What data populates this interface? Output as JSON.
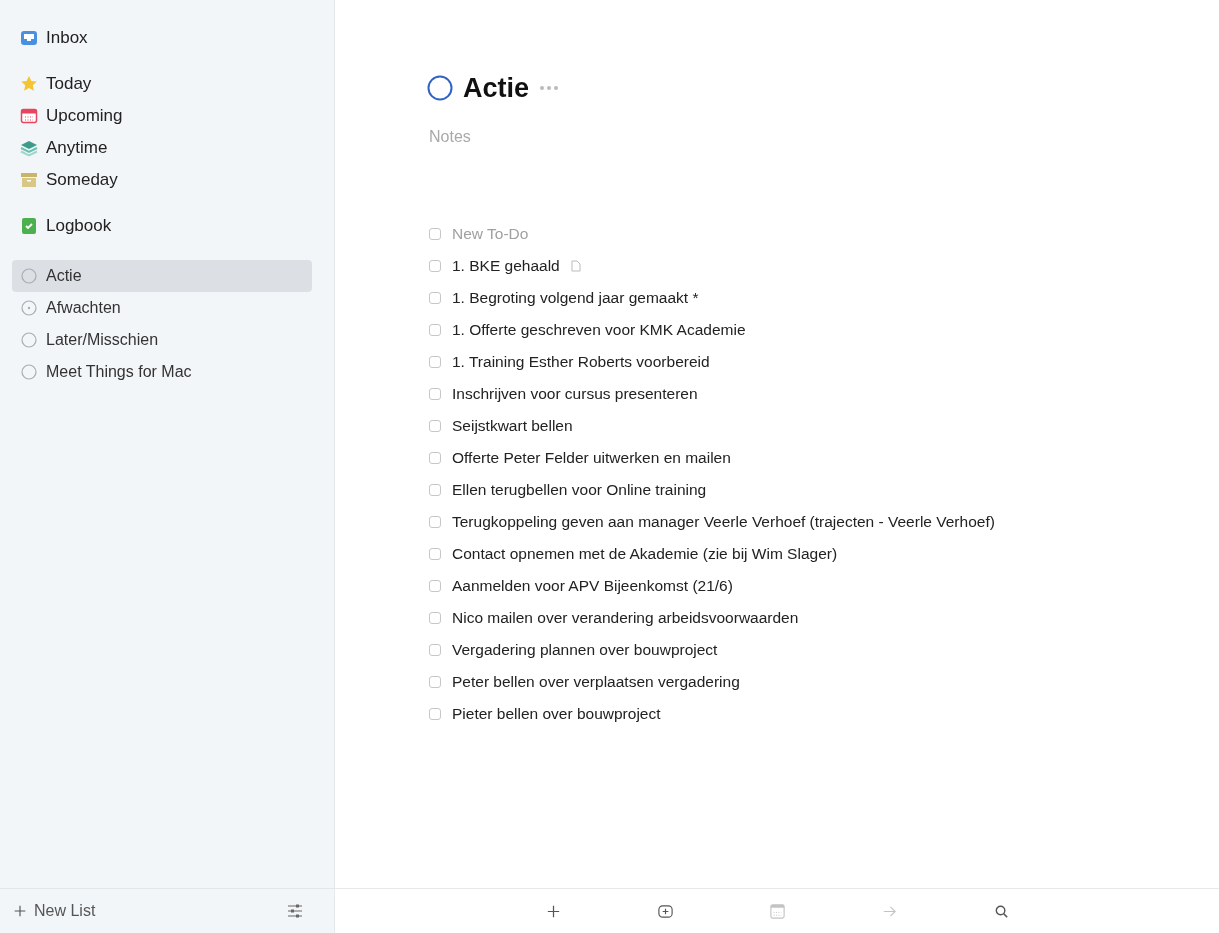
{
  "sidebar": {
    "groups": [
      {
        "items": [
          {
            "label": "Inbox",
            "kind": "inbox",
            "selected": false
          }
        ]
      },
      {
        "items": [
          {
            "label": "Today",
            "kind": "today",
            "selected": false
          },
          {
            "label": "Upcoming",
            "kind": "upcoming",
            "selected": false
          },
          {
            "label": "Anytime",
            "kind": "anytime",
            "selected": false
          },
          {
            "label": "Someday",
            "kind": "someday",
            "selected": false
          }
        ]
      },
      {
        "items": [
          {
            "label": "Logbook",
            "kind": "logbook",
            "selected": false
          }
        ]
      },
      {
        "items": [
          {
            "label": "Actie",
            "kind": "project",
            "selected": true
          },
          {
            "label": "Afwachten",
            "kind": "project-dotted",
            "selected": false
          },
          {
            "label": "Later/Misschien",
            "kind": "project",
            "selected": false
          },
          {
            "label": "Meet Things for Mac",
            "kind": "project",
            "selected": false
          }
        ]
      }
    ],
    "footer": {
      "new_list": "New List"
    }
  },
  "project": {
    "title": "Actie",
    "notes_placeholder": "Notes"
  },
  "tasks": [
    {
      "title": "New To-Do",
      "kind": "placeholder",
      "checked": false,
      "has_note": false
    },
    {
      "title": "1. BKE gehaald",
      "kind": "todo",
      "checked": false,
      "has_note": true
    },
    {
      "title": "1. Begroting volgend jaar gemaakt *",
      "kind": "todo",
      "checked": false,
      "has_note": false
    },
    {
      "title": "1. Offerte geschreven voor KMK Academie",
      "kind": "todo",
      "checked": false,
      "has_note": false
    },
    {
      "title": "1. Training Esther Roberts voorbereid",
      "kind": "todo",
      "checked": false,
      "has_note": false
    },
    {
      "title": "Inschrijven voor cursus presenteren",
      "kind": "todo",
      "checked": false,
      "has_note": false
    },
    {
      "title": "Seijstkwart bellen",
      "kind": "todo",
      "checked": false,
      "has_note": false
    },
    {
      "title": "Offerte Peter Felder uitwerken en mailen",
      "kind": "todo",
      "checked": false,
      "has_note": false
    },
    {
      "title": "Ellen terugbellen voor Online training",
      "kind": "todo",
      "checked": false,
      "has_note": false
    },
    {
      "title": "Terugkoppeling geven aan manager Veerle Verhoef (trajecten - Veerle Verhoef)",
      "kind": "todo",
      "checked": false,
      "has_note": false
    },
    {
      "title": "Contact opnemen met de Akademie (zie bij Wim Slager)",
      "kind": "todo",
      "checked": false,
      "has_note": false
    },
    {
      "title": "Aanmelden voor APV Bijeenkomst (21/6)",
      "kind": "todo",
      "checked": false,
      "has_note": false
    },
    {
      "title": "Nico mailen over verandering arbeidsvoorwaarden",
      "kind": "todo",
      "checked": false,
      "has_note": false
    },
    {
      "title": "Vergadering plannen over bouwproject",
      "kind": "todo",
      "checked": false,
      "has_note": false
    },
    {
      "title": "Peter bellen over verplaatsen vergadering",
      "kind": "todo",
      "checked": false,
      "has_note": false
    },
    {
      "title": "Pieter bellen over bouwproject",
      "kind": "todo",
      "checked": false,
      "has_note": false
    }
  ],
  "toolbar": [
    {
      "kind": "add",
      "disabled": false
    },
    {
      "kind": "add-heading",
      "disabled": false
    },
    {
      "kind": "calendar",
      "disabled": true
    },
    {
      "kind": "move",
      "disabled": true
    },
    {
      "kind": "search",
      "disabled": false
    }
  ]
}
